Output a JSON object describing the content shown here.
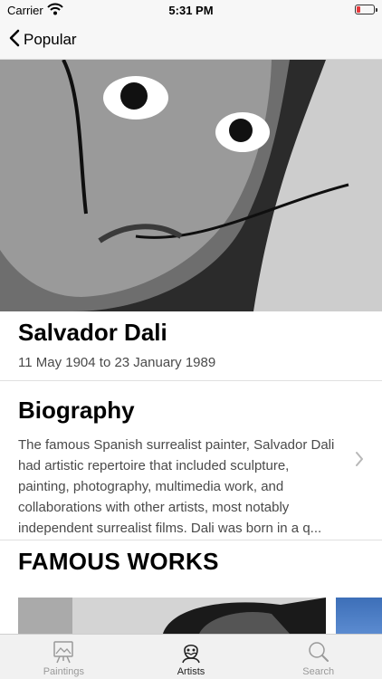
{
  "status_bar": {
    "carrier": "Carrier",
    "time": "5:31 PM",
    "battery_level": 0.2
  },
  "nav": {
    "back_label": "Popular"
  },
  "artist": {
    "name": "Salvador Dali",
    "dates": "11 May 1904 to 23 January 1989"
  },
  "biography": {
    "title": "Biography",
    "text": "The famous Spanish surrealist painter, Salvador Dali had artistic repertoire that included sculpture, painting, photography, multimedia work, and collaborations with other artists, most notably independent surrealist films. Dali was born in a q..."
  },
  "works": {
    "title": "FAMOUS WORKS"
  },
  "tabs": [
    {
      "label": "Paintings",
      "icon": "easel-icon",
      "active": false
    },
    {
      "label": "Artists",
      "icon": "artist-icon",
      "active": true
    },
    {
      "label": "Search",
      "icon": "search-icon",
      "active": false
    }
  ],
  "colors": {
    "bar_background": "#f7f7f7",
    "battery_low": "#e5393b",
    "secondary_text": "#4a4a4a",
    "inactive_tab": "#999999",
    "active_tab": "#222222"
  }
}
